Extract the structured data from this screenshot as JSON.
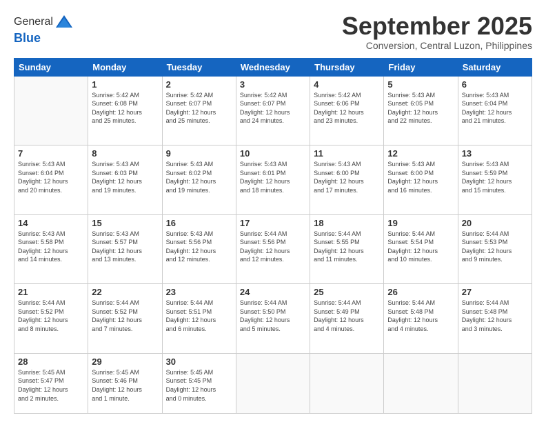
{
  "header": {
    "logo_general": "General",
    "logo_blue": "Blue",
    "month_title": "September 2025",
    "subtitle": "Conversion, Central Luzon, Philippines"
  },
  "days_of_week": [
    "Sunday",
    "Monday",
    "Tuesday",
    "Wednesday",
    "Thursday",
    "Friday",
    "Saturday"
  ],
  "weeks": [
    [
      {
        "day": "",
        "info": ""
      },
      {
        "day": "1",
        "info": "Sunrise: 5:42 AM\nSunset: 6:08 PM\nDaylight: 12 hours\nand 25 minutes."
      },
      {
        "day": "2",
        "info": "Sunrise: 5:42 AM\nSunset: 6:07 PM\nDaylight: 12 hours\nand 25 minutes."
      },
      {
        "day": "3",
        "info": "Sunrise: 5:42 AM\nSunset: 6:07 PM\nDaylight: 12 hours\nand 24 minutes."
      },
      {
        "day": "4",
        "info": "Sunrise: 5:42 AM\nSunset: 6:06 PM\nDaylight: 12 hours\nand 23 minutes."
      },
      {
        "day": "5",
        "info": "Sunrise: 5:43 AM\nSunset: 6:05 PM\nDaylight: 12 hours\nand 22 minutes."
      },
      {
        "day": "6",
        "info": "Sunrise: 5:43 AM\nSunset: 6:04 PM\nDaylight: 12 hours\nand 21 minutes."
      }
    ],
    [
      {
        "day": "7",
        "info": "Sunrise: 5:43 AM\nSunset: 6:04 PM\nDaylight: 12 hours\nand 20 minutes."
      },
      {
        "day": "8",
        "info": "Sunrise: 5:43 AM\nSunset: 6:03 PM\nDaylight: 12 hours\nand 19 minutes."
      },
      {
        "day": "9",
        "info": "Sunrise: 5:43 AM\nSunset: 6:02 PM\nDaylight: 12 hours\nand 19 minutes."
      },
      {
        "day": "10",
        "info": "Sunrise: 5:43 AM\nSunset: 6:01 PM\nDaylight: 12 hours\nand 18 minutes."
      },
      {
        "day": "11",
        "info": "Sunrise: 5:43 AM\nSunset: 6:00 PM\nDaylight: 12 hours\nand 17 minutes."
      },
      {
        "day": "12",
        "info": "Sunrise: 5:43 AM\nSunset: 6:00 PM\nDaylight: 12 hours\nand 16 minutes."
      },
      {
        "day": "13",
        "info": "Sunrise: 5:43 AM\nSunset: 5:59 PM\nDaylight: 12 hours\nand 15 minutes."
      }
    ],
    [
      {
        "day": "14",
        "info": "Sunrise: 5:43 AM\nSunset: 5:58 PM\nDaylight: 12 hours\nand 14 minutes."
      },
      {
        "day": "15",
        "info": "Sunrise: 5:43 AM\nSunset: 5:57 PM\nDaylight: 12 hours\nand 13 minutes."
      },
      {
        "day": "16",
        "info": "Sunrise: 5:43 AM\nSunset: 5:56 PM\nDaylight: 12 hours\nand 12 minutes."
      },
      {
        "day": "17",
        "info": "Sunrise: 5:44 AM\nSunset: 5:56 PM\nDaylight: 12 hours\nand 12 minutes."
      },
      {
        "day": "18",
        "info": "Sunrise: 5:44 AM\nSunset: 5:55 PM\nDaylight: 12 hours\nand 11 minutes."
      },
      {
        "day": "19",
        "info": "Sunrise: 5:44 AM\nSunset: 5:54 PM\nDaylight: 12 hours\nand 10 minutes."
      },
      {
        "day": "20",
        "info": "Sunrise: 5:44 AM\nSunset: 5:53 PM\nDaylight: 12 hours\nand 9 minutes."
      }
    ],
    [
      {
        "day": "21",
        "info": "Sunrise: 5:44 AM\nSunset: 5:52 PM\nDaylight: 12 hours\nand 8 minutes."
      },
      {
        "day": "22",
        "info": "Sunrise: 5:44 AM\nSunset: 5:52 PM\nDaylight: 12 hours\nand 7 minutes."
      },
      {
        "day": "23",
        "info": "Sunrise: 5:44 AM\nSunset: 5:51 PM\nDaylight: 12 hours\nand 6 minutes."
      },
      {
        "day": "24",
        "info": "Sunrise: 5:44 AM\nSunset: 5:50 PM\nDaylight: 12 hours\nand 5 minutes."
      },
      {
        "day": "25",
        "info": "Sunrise: 5:44 AM\nSunset: 5:49 PM\nDaylight: 12 hours\nand 4 minutes."
      },
      {
        "day": "26",
        "info": "Sunrise: 5:44 AM\nSunset: 5:48 PM\nDaylight: 12 hours\nand 4 minutes."
      },
      {
        "day": "27",
        "info": "Sunrise: 5:44 AM\nSunset: 5:48 PM\nDaylight: 12 hours\nand 3 minutes."
      }
    ],
    [
      {
        "day": "28",
        "info": "Sunrise: 5:45 AM\nSunset: 5:47 PM\nDaylight: 12 hours\nand 2 minutes."
      },
      {
        "day": "29",
        "info": "Sunrise: 5:45 AM\nSunset: 5:46 PM\nDaylight: 12 hours\nand 1 minute."
      },
      {
        "day": "30",
        "info": "Sunrise: 5:45 AM\nSunset: 5:45 PM\nDaylight: 12 hours\nand 0 minutes."
      },
      {
        "day": "",
        "info": ""
      },
      {
        "day": "",
        "info": ""
      },
      {
        "day": "",
        "info": ""
      },
      {
        "day": "",
        "info": ""
      }
    ]
  ]
}
